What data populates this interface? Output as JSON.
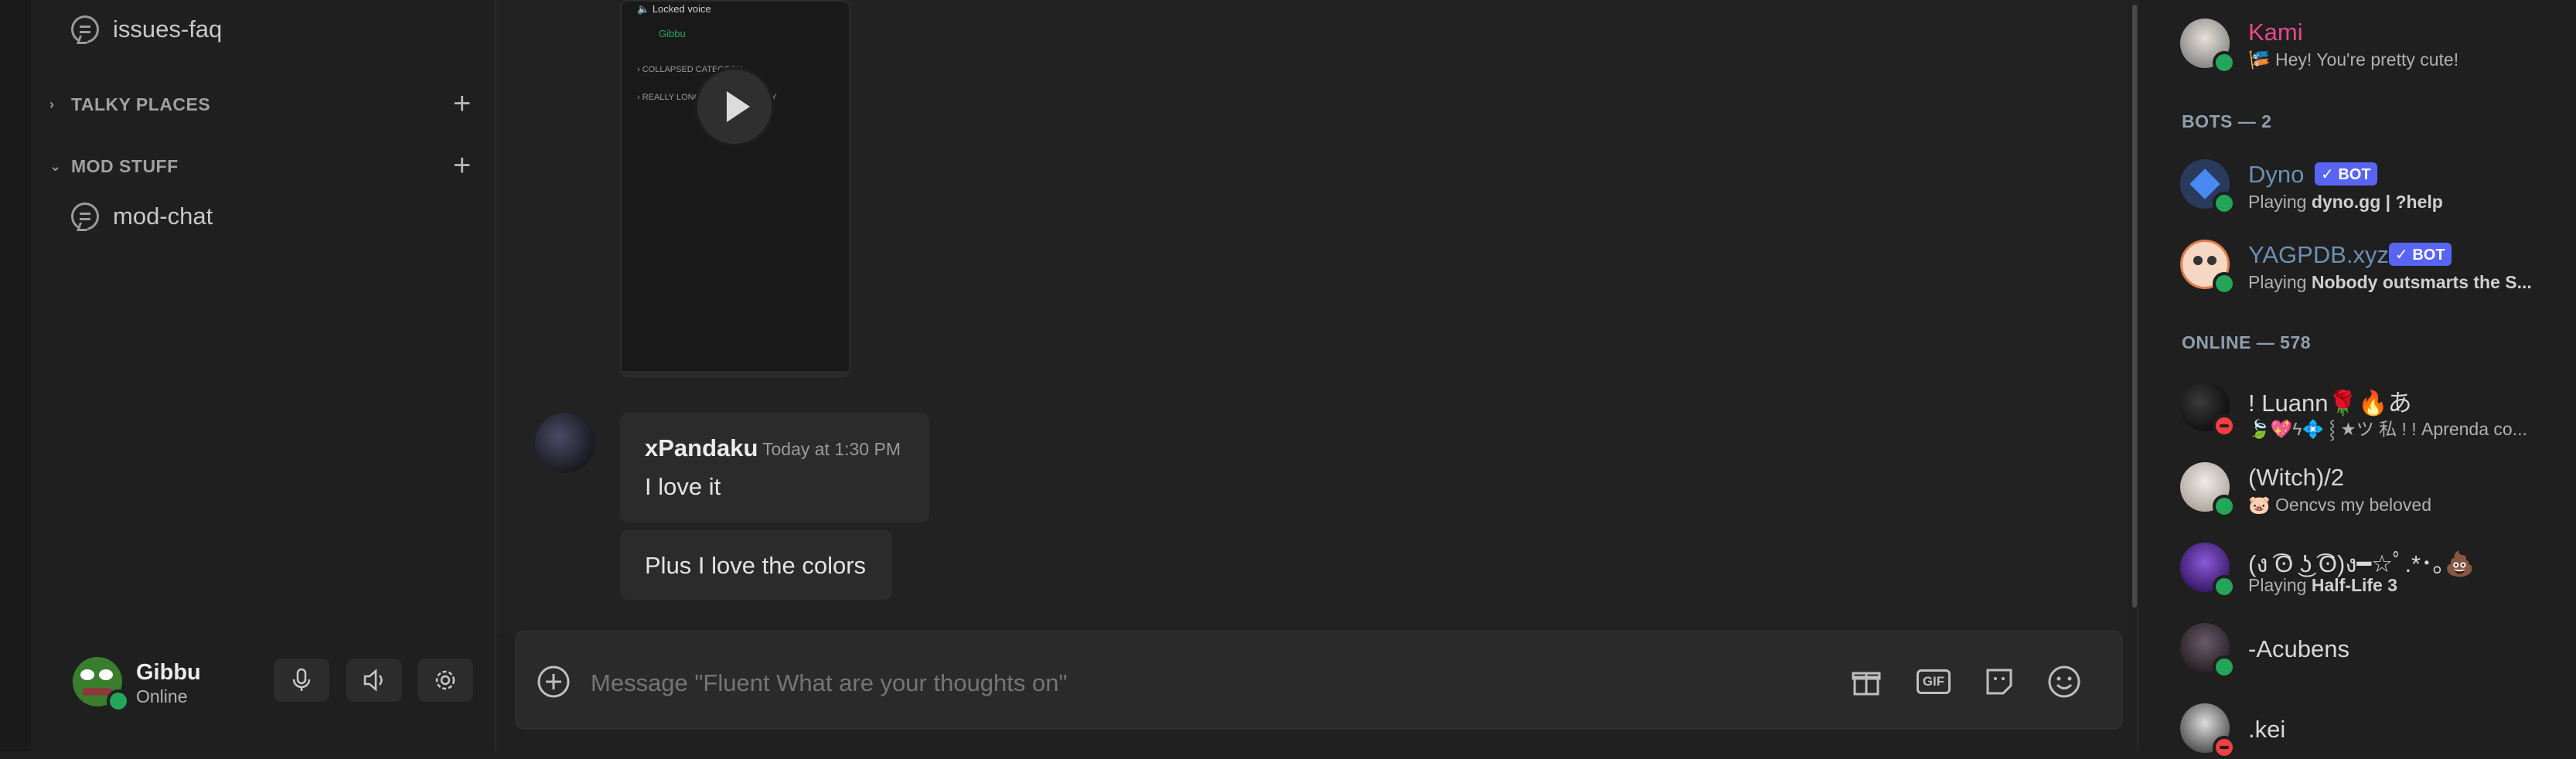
{
  "sidebar": {
    "channels": [
      {
        "label": "issues-faq"
      },
      {
        "label": "mod-chat"
      }
    ],
    "categories": [
      {
        "label": "TALKY PLACES",
        "chevron": "›"
      },
      {
        "label": "MOD STUFF",
        "chevron": "⌄"
      }
    ]
  },
  "video": {
    "locked_voice": "Locked voice",
    "voice_user": "Gibbu",
    "collapsed_category": "› COLLAPSED CATEGORY",
    "long_category": "› REALLY LONG NAME CATEGORY"
  },
  "messages": [
    {
      "author": "xPandaku",
      "timestamp": "Today at 1:30 PM",
      "text": "I love it"
    },
    {
      "text": "Plus I love the colors"
    }
  ],
  "user_panel": {
    "name": "Gibbu",
    "status": "Online"
  },
  "composer": {
    "placeholder": "Message \"Fluent What are your thoughts on\"",
    "gif_label": "GIF"
  },
  "members": {
    "top": {
      "name": "Kami",
      "status_emoji": "🎏",
      "status": "Hey! You're pretty cute!",
      "name_color": "#e8488a"
    },
    "bots_header": "BOTS — 2",
    "bots": [
      {
        "name": "Dyno",
        "badge": "✓ BOT",
        "activity_prefix": "Playing ",
        "activity": "dyno.gg | ?help"
      },
      {
        "name": "YAGPDB.xyz",
        "badge": "✓ BOT",
        "activity_prefix": "Playing ",
        "activity": "Nobody outsmarts the S..."
      }
    ],
    "online_header": "ONLINE — 578",
    "online": [
      {
        "name": "! Luann🌹🔥あ",
        "status": "🍃💖ϟ💠 ⸾ ★ツ 私 ! ! Aprenda co...",
        "presence": "dnd"
      },
      {
        "name": "(Witch)/2",
        "status": "🐷 Oencvs my beloved",
        "presence": "online"
      },
      {
        "name": "(ง ͡ʘ ͜ʖ ͡ʘ)ง━☆ﾟ.*･｡💩",
        "status_prefix": "Playing ",
        "status_bold": "Half-Life 3",
        "presence": "online"
      },
      {
        "name": "-Acubens",
        "presence": "online"
      },
      {
        "name": ".kei",
        "presence": "dnd"
      }
    ]
  },
  "colors": {
    "accent": "#5865f2",
    "online": "#23a55a",
    "dnd": "#f23f43",
    "bot_name": "#6c8fb4"
  }
}
